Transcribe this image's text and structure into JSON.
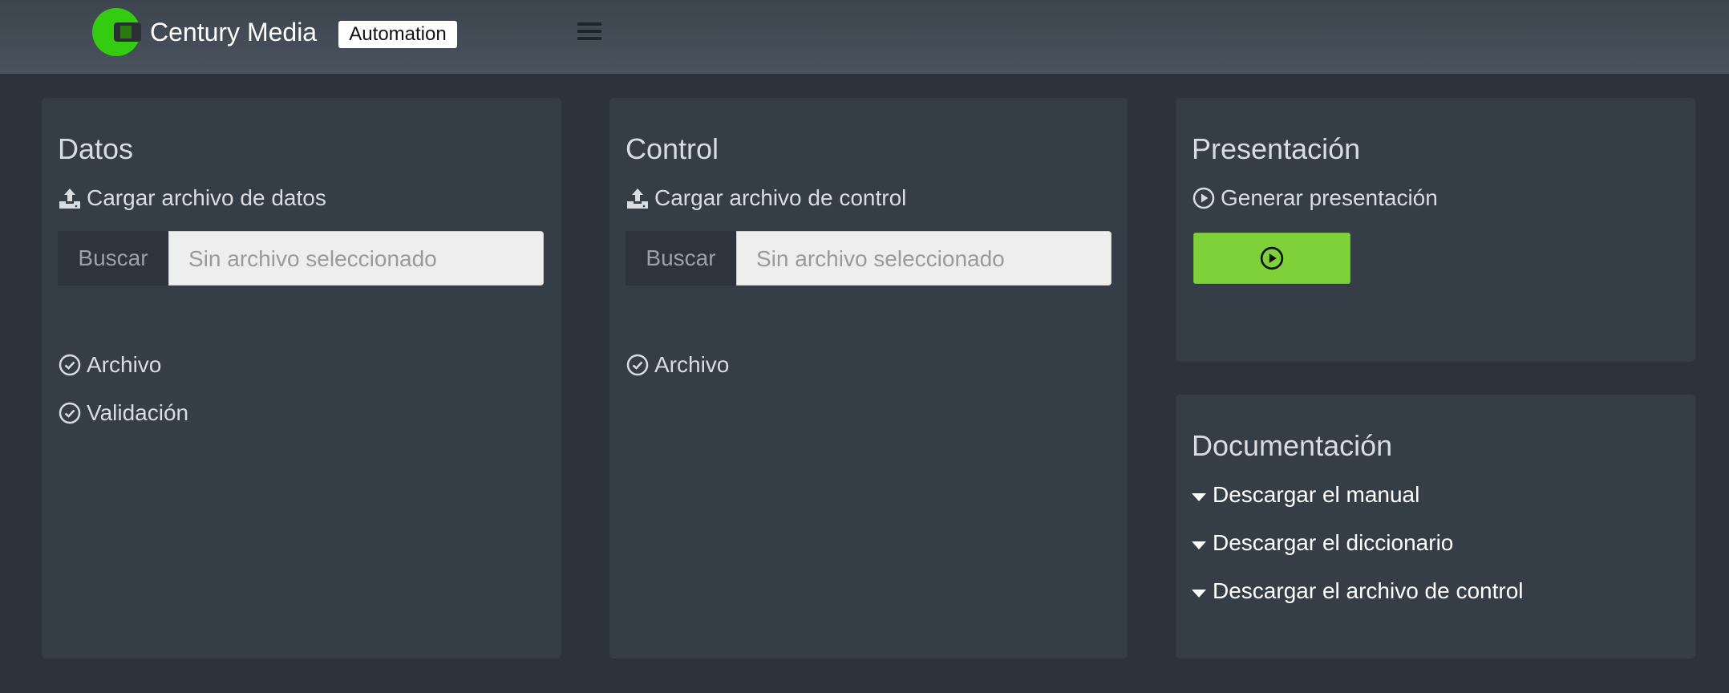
{
  "header": {
    "brand": "Century Media",
    "badge": "Automation",
    "logo_color": "#33cc11",
    "menu_icon": "hamburger-icon"
  },
  "cards": {
    "datos": {
      "title": "Datos",
      "upload_label": "Cargar archivo de datos",
      "browse_label": "Buscar",
      "file_placeholder": "Sin archivo seleccionado",
      "checks": [
        "Archivo",
        "Validación"
      ]
    },
    "control": {
      "title": "Control",
      "upload_label": "Cargar archivo de control",
      "browse_label": "Buscar",
      "file_placeholder": "Sin archivo seleccionado",
      "checks": [
        "Archivo"
      ]
    },
    "presentacion": {
      "title": "Presentación",
      "action_label": "Generar presentación",
      "button_color": "#7fd13a"
    },
    "documentacion": {
      "title": "Documentación",
      "links": [
        "Descargar el manual",
        "Descargar el diccionario",
        "Descargar el archivo de control"
      ]
    }
  },
  "colors": {
    "background": "#2c333c",
    "card": "#353d47",
    "accent": "#7fd13a"
  }
}
